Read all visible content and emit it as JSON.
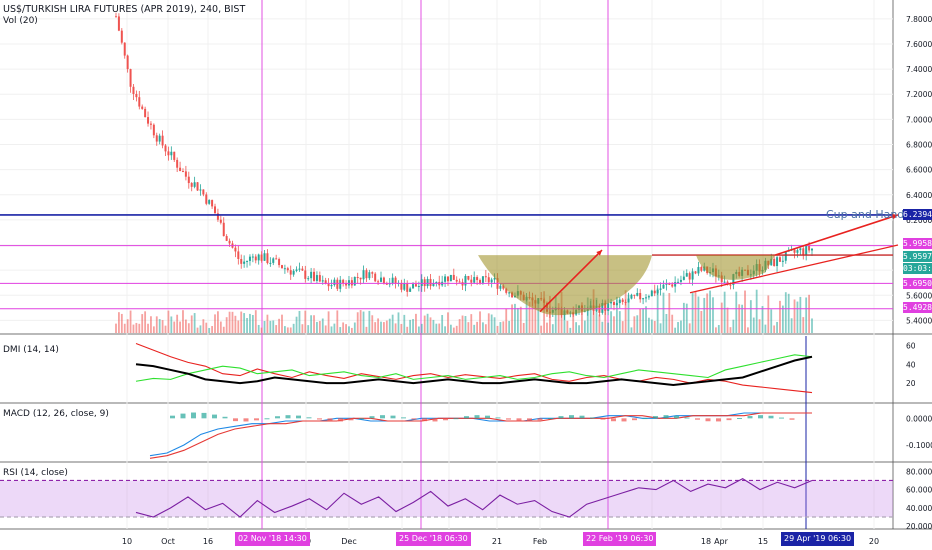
{
  "header": {
    "symbol_title": "US$/TURKISH LIRA FUTURES (APR 2019), 240, BIST",
    "vol_label": "Vol (20)",
    "dmi_label": "DMI (14, 14)",
    "macd_label": "MACD (12, 26, close, 9)",
    "rsi_label": "RSI (14, close)"
  },
  "annotation": {
    "pattern_text": "Cup and Handle"
  },
  "price_tags": [
    {
      "text": "6.2394",
      "color": "#1a23a6",
      "value": 6.2394
    },
    {
      "text": "5.9958",
      "color": "#e040e0",
      "value": 5.9958
    },
    {
      "text": "5.9597",
      "color": "#26a69a",
      "value": 5.9597
    },
    {
      "text": "03:03:50",
      "color": "#26a69a",
      "value": 5.9
    },
    {
      "text": "5.6950",
      "color": "#e040e0",
      "value": 5.695
    },
    {
      "text": "5.4928",
      "color": "#e040e0",
      "value": 5.4928
    }
  ],
  "date_tags": [
    {
      "text": "02 Nov '18   14:30",
      "color": "#e040e0"
    },
    {
      "text": "25 Dec '18   06:30",
      "color": "#e040e0"
    },
    {
      "text": "22 Feb '19   06:30",
      "color": "#e040e0"
    },
    {
      "text": "29 Apr '19   06:30",
      "color": "#1a23a6"
    }
  ],
  "chart_data": [
    {
      "type": "candlestick",
      "title": "US$/TURKISH LIRA FUTURES (APR 2019), 240, BIST",
      "x_ticks": [
        "10",
        "Oct",
        "16",
        "Nov",
        "19",
        "Dec",
        "9",
        "21",
        "Feb",
        "18",
        "Apr",
        "15",
        "20"
      ],
      "y_ticks": [
        5.4,
        5.6,
        5.8,
        6.0,
        6.2,
        6.4,
        6.6,
        6.8,
        7.0,
        7.2,
        7.4,
        7.6,
        7.8
      ],
      "ylim": [
        5.3,
        7.95
      ],
      "y_tick_labels": [
        "5.4000",
        "5.6000",
        "5.8000",
        "6.0000",
        "6.2000",
        "6.4000",
        "6.6000",
        "6.8000",
        "7.0000",
        "7.2000",
        "7.4000",
        "7.6000",
        "7.8000"
      ],
      "price_path": [
        [
          0.0,
          7.82
        ],
        [
          0.02,
          7.3
        ],
        [
          0.04,
          7.05
        ],
        [
          0.06,
          6.85
        ],
        [
          0.08,
          6.7
        ],
        [
          0.1,
          6.55
        ],
        [
          0.12,
          6.45
        ],
        [
          0.14,
          6.28
        ],
        [
          0.16,
          6.05
        ],
        [
          0.18,
          5.85
        ],
        [
          0.2,
          5.92
        ],
        [
          0.22,
          5.88
        ],
        [
          0.25,
          5.8
        ],
        [
          0.28,
          5.75
        ],
        [
          0.3,
          5.68
        ],
        [
          0.33,
          5.7
        ],
        [
          0.36,
          5.78
        ],
        [
          0.39,
          5.72
        ],
        [
          0.42,
          5.66
        ],
        [
          0.45,
          5.7
        ],
        [
          0.48,
          5.75
        ],
        [
          0.51,
          5.7
        ],
        [
          0.54,
          5.72
        ],
        [
          0.57,
          5.62
        ],
        [
          0.6,
          5.55
        ],
        [
          0.63,
          5.48
        ],
        [
          0.66,
          5.47
        ],
        [
          0.69,
          5.5
        ],
        [
          0.72,
          5.52
        ],
        [
          0.75,
          5.58
        ],
        [
          0.78,
          5.65
        ],
        [
          0.81,
          5.72
        ],
        [
          0.84,
          5.8
        ],
        [
          0.86,
          5.78
        ],
        [
          0.88,
          5.72
        ],
        [
          0.9,
          5.76
        ],
        [
          0.92,
          5.82
        ],
        [
          0.94,
          5.85
        ],
        [
          0.96,
          5.9
        ],
        [
          0.98,
          5.95
        ],
        [
          1.0,
          5.97
        ]
      ],
      "horizontal_levels": [
        6.2394,
        5.9958,
        5.92,
        5.695,
        5.4928
      ],
      "volume_note": "Vol (20)"
    },
    {
      "type": "line",
      "title": "DMI (14, 14)",
      "y_ticks": [
        20,
        40,
        60
      ],
      "ylim": [
        0,
        70
      ],
      "series": [
        {
          "color": "#e8221f",
          "values": [
            62,
            55,
            48,
            42,
            38,
            30,
            28,
            35,
            30,
            26,
            32,
            28,
            25,
            30,
            27,
            24,
            28,
            30,
            26,
            29,
            27,
            25,
            28,
            30,
            24,
            22,
            26,
            28,
            24,
            22,
            26,
            24,
            20,
            24,
            22,
            18,
            16,
            14,
            12,
            10
          ]
        },
        {
          "color": "#2ee02e",
          "values": [
            22,
            25,
            24,
            30,
            34,
            38,
            36,
            30,
            32,
            34,
            28,
            30,
            32,
            28,
            26,
            30,
            24,
            26,
            28,
            24,
            26,
            28,
            24,
            26,
            30,
            32,
            28,
            26,
            30,
            34,
            32,
            30,
            28,
            26,
            34,
            38,
            42,
            46,
            50,
            48
          ]
        },
        {
          "color": "#000000",
          "values": [
            40,
            38,
            34,
            30,
            24,
            22,
            20,
            22,
            26,
            24,
            22,
            20,
            20,
            22,
            24,
            22,
            20,
            22,
            24,
            22,
            20,
            20,
            22,
            24,
            22,
            20,
            20,
            22,
            24,
            22,
            20,
            18,
            20,
            22,
            24,
            26,
            32,
            38,
            44,
            48
          ]
        }
      ]
    },
    {
      "type": "line",
      "title": "MACD (12, 26, close, 9)",
      "y_ticks": [
        0.0,
        -0.1
      ],
      "y_tick_labels": [
        "0.0000",
        "-0.1000"
      ],
      "ylim": [
        -0.16,
        0.05
      ],
      "series": [
        {
          "color": "#1e88e5",
          "values": [
            -0.14,
            -0.13,
            -0.1,
            -0.06,
            -0.04,
            -0.03,
            -0.02,
            -0.02,
            -0.01,
            -0.01,
            -0.01,
            0.0,
            0.0,
            -0.01,
            -0.01,
            -0.01,
            0.0,
            0.0,
            0.0,
            0.0,
            -0.01,
            -0.01,
            -0.01,
            0.0,
            0.0,
            0.0,
            0.0,
            0.01,
            0.01,
            0.0,
            0.0,
            0.01,
            0.01,
            0.01,
            0.01,
            0.02,
            0.02,
            0.02,
            0.02,
            0.02
          ]
        },
        {
          "color": "#e53935",
          "values": [
            -0.15,
            -0.14,
            -0.12,
            -0.09,
            -0.06,
            -0.04,
            -0.03,
            -0.02,
            -0.02,
            -0.01,
            -0.01,
            -0.01,
            0.0,
            0.0,
            -0.01,
            -0.01,
            -0.01,
            0.0,
            0.0,
            0.0,
            0.0,
            -0.01,
            -0.01,
            -0.01,
            0.0,
            0.0,
            0.0,
            0.0,
            0.01,
            0.01,
            0.0,
            0.0,
            0.01,
            0.01,
            0.01,
            0.01,
            0.02,
            0.02,
            0.02,
            0.02
          ]
        }
      ]
    },
    {
      "type": "line",
      "title": "RSI (14, close)",
      "y_ticks": [
        20,
        40,
        60,
        80
      ],
      "y_tick_labels": [
        "20.0000",
        "40.0000",
        "60.0000",
        "80.0000"
      ],
      "ylim": [
        18,
        88
      ],
      "levels": [
        70,
        30
      ],
      "series": [
        {
          "color": "#7b1fa2",
          "values": [
            35,
            30,
            40,
            52,
            38,
            45,
            30,
            48,
            35,
            42,
            50,
            38,
            56,
            44,
            52,
            36,
            46,
            58,
            42,
            50,
            38,
            54,
            44,
            48,
            36,
            30,
            44,
            50,
            56,
            62,
            60,
            70,
            58,
            66,
            62,
            72,
            60,
            68,
            62,
            70
          ]
        }
      ]
    }
  ]
}
